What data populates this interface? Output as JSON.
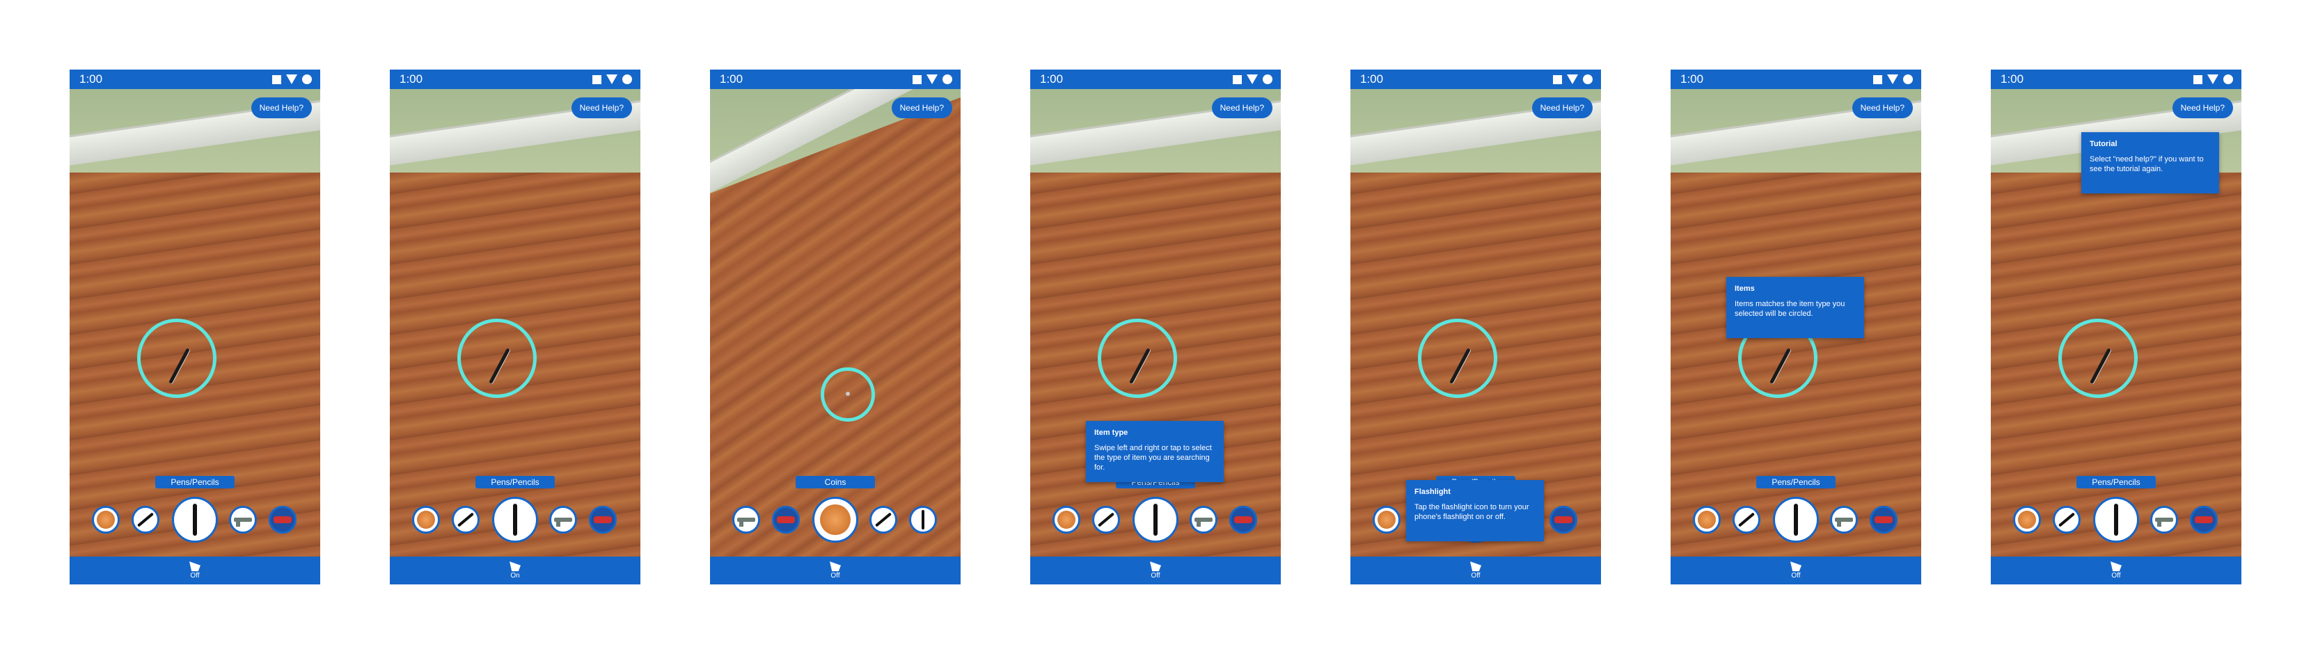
{
  "status_time": "1:00",
  "help_label": "Need Help?",
  "flashlight_off": "Off",
  "flashlight_on": "On",
  "screens": [
    {
      "category": "Pens/Pencils",
      "flashlight": "Off"
    },
    {
      "category": "Pens/Pencils",
      "flashlight": "On"
    },
    {
      "category": "Coins",
      "flashlight": "Off"
    },
    {
      "category": "Pens/Pencils",
      "flashlight": "Off",
      "tooltip": {
        "title": "Item type",
        "body": "Swipe left and right or tap to select the type of item you are searching for."
      }
    },
    {
      "category": "Pens/Pencils",
      "flashlight": "Off",
      "tooltip": {
        "title": "Flashlight",
        "body": "Tap the flashlight icon to turn your phone's flashlight on or off."
      }
    },
    {
      "category": "Pens/Pencils",
      "flashlight": "Off",
      "tooltip": {
        "title": "Items",
        "body": "Items matches the item type you selected will be circled."
      }
    },
    {
      "category": "Pens/Pencils",
      "flashlight": "Off",
      "tooltip": {
        "title": "Tutorial",
        "body": "Select \"need help?\" if you want to see the tutorial again."
      }
    }
  ],
  "icons": [
    "square-nav-icon",
    "triangle-signal-icon",
    "circle-battery-icon",
    "flashlight-icon"
  ],
  "colors": {
    "brand_blue": "#1566c9",
    "reticle": "#5ce6de"
  }
}
